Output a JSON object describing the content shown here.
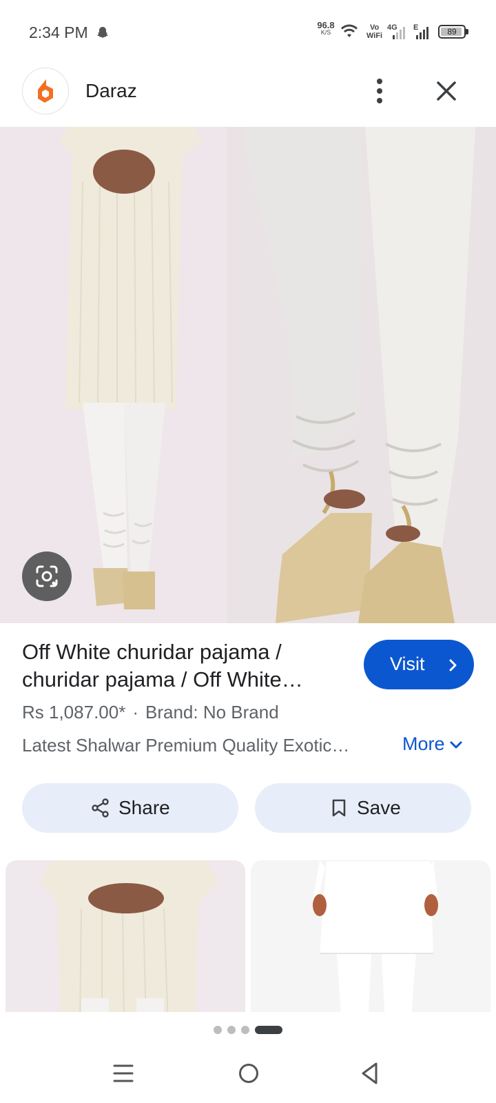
{
  "status_bar": {
    "time": "2:34 PM",
    "net_speed_value": "96.8",
    "net_speed_unit": "K/S",
    "vowifi_top": "Vo",
    "vowifi_bottom": "WiFi",
    "network_4g": "4G",
    "network_e": "E",
    "battery_level": "89",
    "icons": [
      "snapchat-icon",
      "wifi-icon",
      "signal-icon",
      "battery-icon"
    ]
  },
  "header": {
    "site_name": "Daraz",
    "logo_color": "#f36f21",
    "icons": [
      "daraz-logo-icon",
      "more-vert-icon",
      "close-icon"
    ]
  },
  "product": {
    "title_line1": "Off White churidar pajama /",
    "title_line2": "churidar pajama / Off White…",
    "visit_label": "Visit",
    "price": "Rs 1,087.00*",
    "separator": "·",
    "brand": "Brand: No Brand",
    "description": "Latest Shalwar Premium Quality Exotic…",
    "more_label": "More"
  },
  "actions": {
    "share_label": "Share",
    "save_label": "Save"
  },
  "pagination": {
    "total": 4,
    "active": 4
  },
  "colors": {
    "accent": "#0b57d0",
    "action_bg": "#e8eef9",
    "image_bg": "#efe8ec"
  }
}
